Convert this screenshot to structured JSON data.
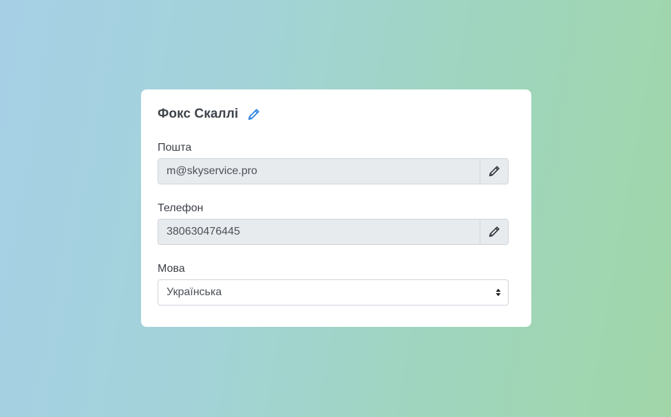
{
  "profile": {
    "name": "Фокс Скаллі",
    "name_edit_icon": "pencil-icon"
  },
  "email": {
    "label": "Пошта",
    "value": "m@skyservice.pro",
    "edit_icon": "pencil-icon"
  },
  "phone": {
    "label": "Телефон",
    "value": "380630476445",
    "edit_icon": "pencil-icon"
  },
  "language": {
    "label": "Мова",
    "selected": "Українська",
    "icon": "sort-arrows-icon"
  },
  "colors": {
    "accent": "#2f86e0",
    "card_bg": "#ffffff",
    "input_bg": "#e8ebee",
    "text": "#3d434a"
  }
}
